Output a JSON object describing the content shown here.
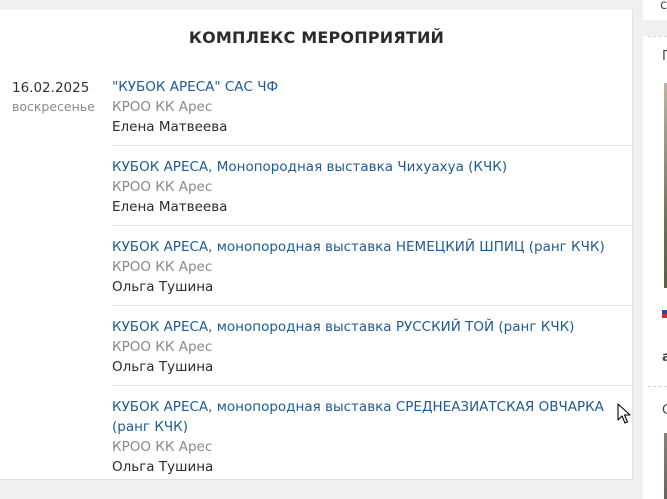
{
  "section": {
    "title": "КОМПЛЕКС МЕРОПРИЯТИЙ",
    "date": "16.02.2025",
    "weekday": "воскресенье"
  },
  "events": [
    {
      "title": "\"КУБОК АРЕСА\" САС ЧФ",
      "organizer": "КРОО КК Арес",
      "person": "Елена Матвеева"
    },
    {
      "title": "КУБОК АРЕСА, Монопородная выставка Чихуахуа (КЧК)",
      "organizer": "КРОО КК Арес",
      "person": "Елена Матвеева"
    },
    {
      "title": "КУБОК АРЕСА, монопородная выставка НЕМЕЦКИЙ ШПИЦ (ранг КЧК)",
      "organizer": "КРОО КК Арес",
      "person": "Ольга Тушина"
    },
    {
      "title": "КУБОК АРЕСА, монопородная выставка РУССКИЙ ТОЙ (ранг КЧК)",
      "organizer": "КРОО КК Арес",
      "person": "Ольга Тушина"
    },
    {
      "title": "КУБОК АРЕСА, монопородная выставка СРЕДНЕАЗИАТСКАЯ ОВЧАРКА (ранг КЧК)",
      "organizer": "КРОО КК Арес",
      "person": "Ольга Тушина"
    }
  ],
  "sidebar_fragments": {
    "letter_top": "c",
    "letter_2": "П",
    "letter_3": "a",
    "letter_4": "C"
  },
  "colors": {
    "link": "#1e5b96",
    "muted": "#888888",
    "text": "#2b2b2b",
    "background": "#eef0f2"
  }
}
